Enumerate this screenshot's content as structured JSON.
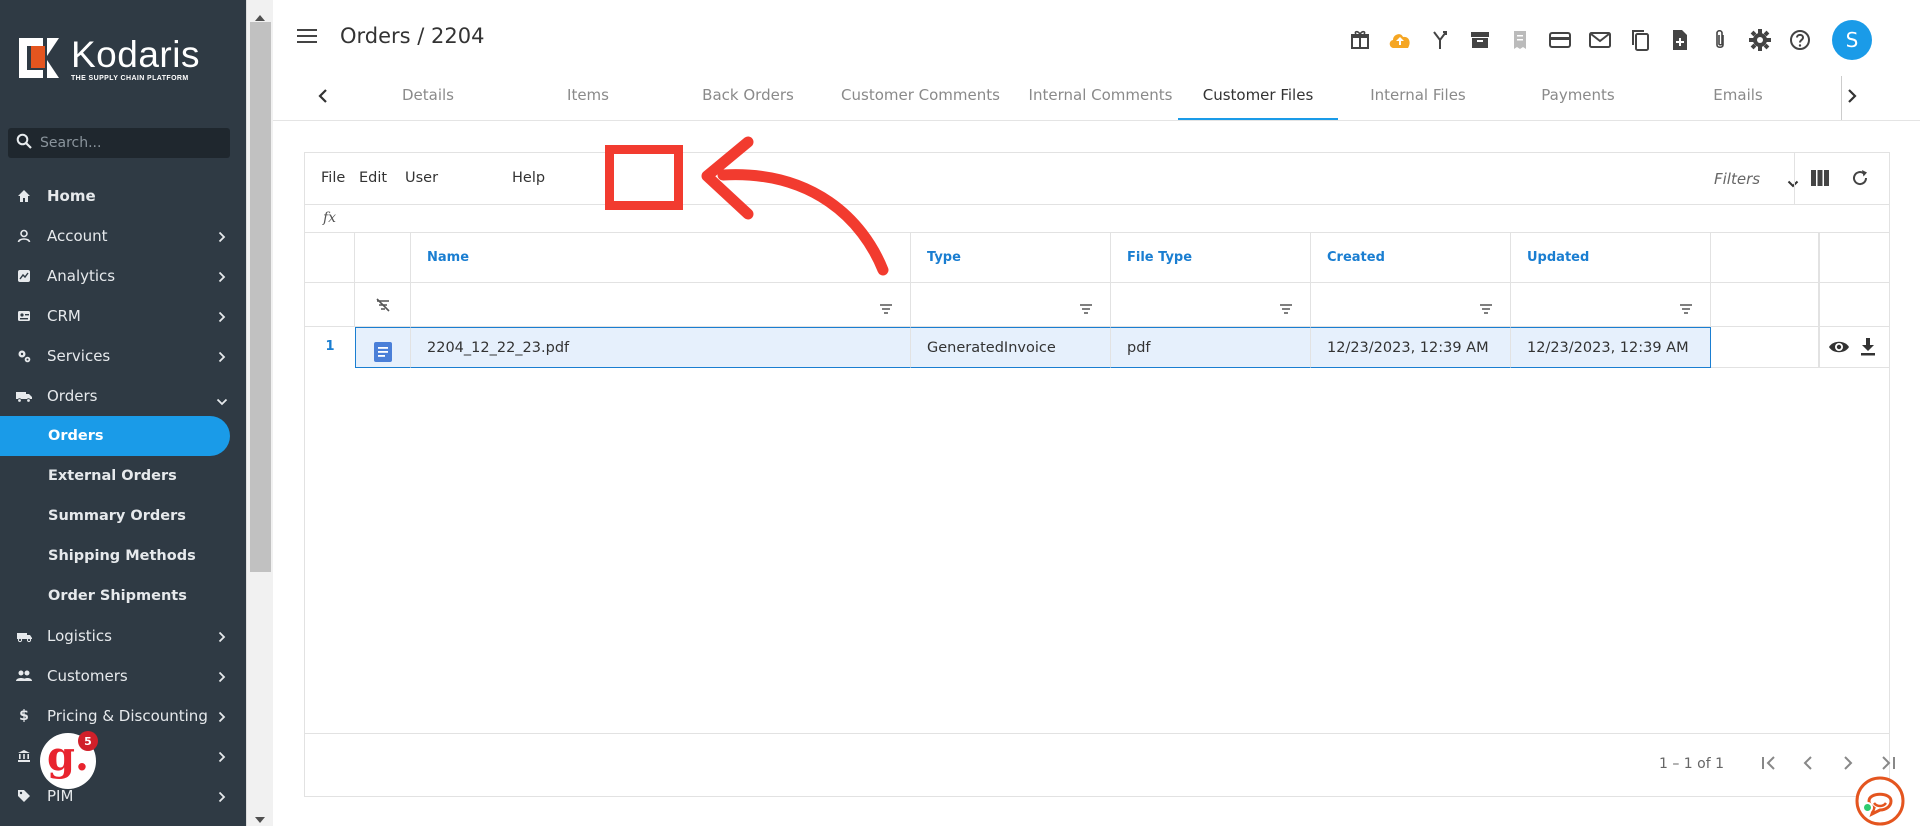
{
  "app": {
    "brand_name": "Kodaris",
    "brand_tagline": "THE SUPPLY CHAIN PLATFORM",
    "brand_color": "#e4551f",
    "accent_color": "#1a9be8"
  },
  "sidebar": {
    "search_placeholder": "Search...",
    "items": [
      {
        "label": "Home",
        "icon": "home-icon"
      },
      {
        "label": "Account",
        "icon": "account-icon"
      },
      {
        "label": "Analytics",
        "icon": "analytics-icon"
      },
      {
        "label": "CRM",
        "icon": "crm-icon"
      },
      {
        "label": "Services",
        "icon": "services-icon"
      },
      {
        "label": "Orders",
        "icon": "truck-icon"
      }
    ],
    "orders_sub": [
      "Orders",
      "External Orders",
      "Summary Orders",
      "Shipping Methods",
      "Order Shipments"
    ],
    "items_after": [
      {
        "label": "Logistics",
        "icon": "logistics-icon"
      },
      {
        "label": "Customers",
        "icon": "customers-icon"
      },
      {
        "label": "Pricing & Discounting",
        "icon": "dollar-icon"
      },
      {
        "label": "",
        "icon": "bank-icon"
      },
      {
        "label": "PIM",
        "icon": "tag-icon"
      }
    ],
    "badge_letter": "g.",
    "badge_count": "5"
  },
  "header": {
    "title": "Orders / 2204",
    "avatar_letter": "S",
    "icons": [
      "gift-icon",
      "cloud-upload-icon",
      "merge-icon",
      "archive-icon",
      "receipt-icon",
      "credit-card-icon",
      "mail-icon",
      "copy-icon",
      "add-file-icon",
      "attachment-icon",
      "settings-icon",
      "help-icon"
    ]
  },
  "tabs": [
    "Details",
    "Items",
    "Back Orders",
    "Customer Comments",
    "Internal Comments",
    "Customer Files",
    "Internal Files",
    "Payments",
    "Emails"
  ],
  "active_tab": "Customer Files",
  "menubar": {
    "file": "File",
    "edit": "Edit",
    "user": "User",
    "help": "Help",
    "filters": "Filters"
  },
  "formula_label": "fx",
  "grid": {
    "columns": [
      "Name",
      "Type",
      "File Type",
      "Created",
      "Updated"
    ],
    "rows": [
      {
        "num": "1",
        "name": "2204_12_22_23.pdf",
        "type": "GeneratedInvoice",
        "file_type": "pdf",
        "created": "12/23/2023, 12:39 AM",
        "updated": "12/23/2023, 12:39 AM"
      }
    ]
  },
  "pager": {
    "text": "1 – 1 of 1"
  },
  "annotation_color": "#f23b2f"
}
